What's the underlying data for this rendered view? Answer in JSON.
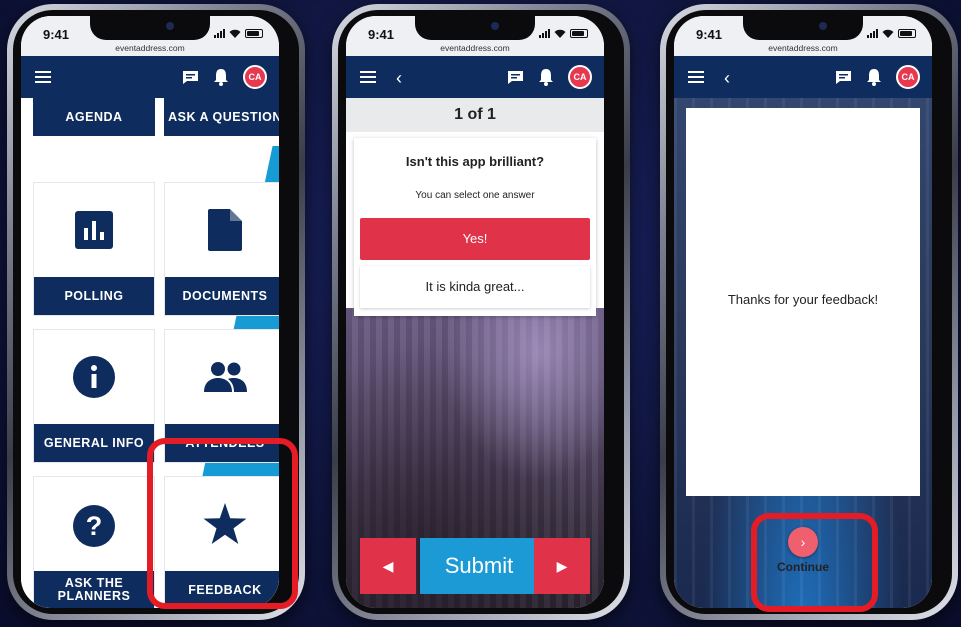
{
  "status": {
    "time": "9:41",
    "url": "eventaddress.com"
  },
  "app": {
    "avatar_initials": "CA"
  },
  "colors": {
    "navy": "#0e2d5e",
    "accent_red": "#e03248",
    "accent_blue": "#1b9ad6",
    "highlight": "#e31c25"
  },
  "menu": {
    "tiles": [
      {
        "label": "AGENDA"
      },
      {
        "label": "ASK A QUESTION"
      },
      {
        "label": "POLLING",
        "icon": "bar-chart-icon"
      },
      {
        "label": "DOCUMENTS",
        "icon": "document-icon"
      },
      {
        "label": "GENERAL INFO",
        "icon": "info-icon"
      },
      {
        "label": "ATTENDEES",
        "icon": "people-icon"
      },
      {
        "label": "ASK THE PLANNERS",
        "icon": "question-icon"
      },
      {
        "label": "FEEDBACK",
        "icon": "star-icon"
      }
    ]
  },
  "poll": {
    "counter": "1 of 1",
    "question": "Isn't this app brilliant?",
    "hint": "You can select one answer",
    "options": [
      "Yes!",
      "It is kinda great..."
    ],
    "submit_label": "Submit"
  },
  "thanks": {
    "message": "Thanks for your feedback!",
    "continue_label": "Continue"
  }
}
